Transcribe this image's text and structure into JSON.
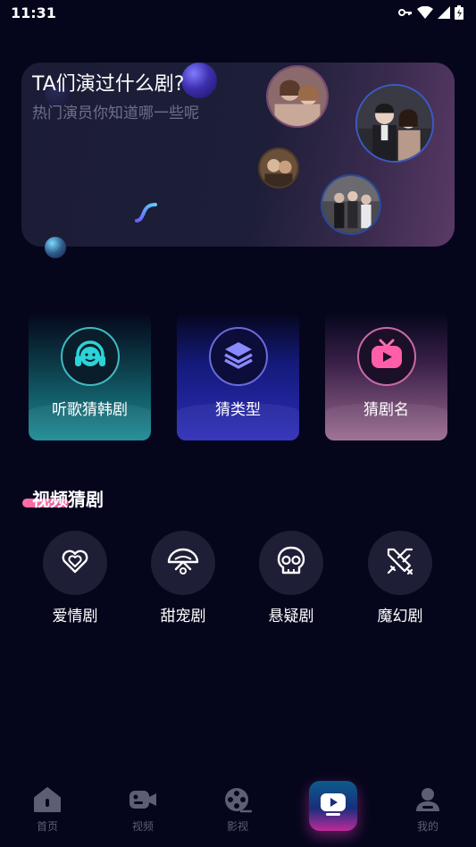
{
  "status_bar": {
    "time": "11:31",
    "icons": [
      "key-icon",
      "wifi-icon",
      "signal-icon",
      "battery-icon"
    ]
  },
  "banner": {
    "title": "TA们演过什么剧?",
    "subtitle": "热门演员你知道哪一些呢",
    "images": [
      "actor-photo-1",
      "actor-photo-2",
      "actor-photo-3",
      "actor-photo-4"
    ]
  },
  "cards": [
    {
      "label": "听歌猜韩剧",
      "icon": "headphones-icon",
      "color": "#1a8a95"
    },
    {
      "label": "猜类型",
      "icon": "layers-icon",
      "color": "#2c2cb8"
    },
    {
      "label": "猜剧名",
      "icon": "tv-icon",
      "color": "#9a6a90"
    }
  ],
  "section": {
    "title": "视频猜剧",
    "accent_color": "#ff6fa8"
  },
  "genres": [
    {
      "label": "爱情剧",
      "icon": "heart-icon"
    },
    {
      "label": "甜宠剧",
      "icon": "fan-icon"
    },
    {
      "label": "悬疑剧",
      "icon": "skull-icon"
    },
    {
      "label": "魔幻剧",
      "icon": "crossed-swords-icon"
    }
  ],
  "bottom_nav": {
    "items": [
      {
        "label": "首页",
        "icon": "home-icon",
        "active": false
      },
      {
        "label": "视频",
        "icon": "video-camera-icon",
        "active": false
      },
      {
        "label": "影视",
        "icon": "film-reel-icon",
        "active": false
      },
      {
        "label": "",
        "icon": "play-icon",
        "active": true
      },
      {
        "label": "我的",
        "icon": "user-icon",
        "active": false
      }
    ]
  }
}
